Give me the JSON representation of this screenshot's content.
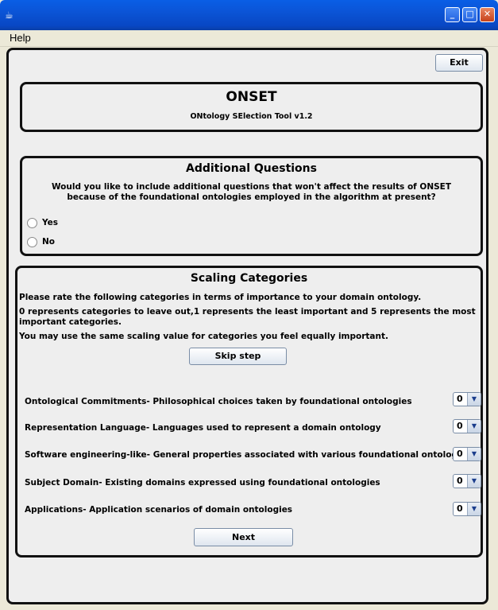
{
  "window": {
    "app_icon_glyph": "☕",
    "minimize_glyph": "_",
    "maximize_glyph": "□",
    "close_glyph": "✕"
  },
  "menu": {
    "help_label": "Help"
  },
  "exit_button_label": "Exit",
  "header": {
    "title": "ONSET",
    "subtitle": "ONtology SElection Tool  v1.2"
  },
  "additional_questions": {
    "title": "Additional Questions",
    "question_line1": "Would you like to include additional questions that won't affect the results of ONSET",
    "question_line2": "because of the foundational ontologies employed in the algorithm at present?",
    "options": [
      {
        "label": "Yes",
        "selected": false
      },
      {
        "label": "No",
        "selected": false
      }
    ]
  },
  "scaling": {
    "title": "Scaling Categories",
    "instructions": [
      "Please rate the following categories in terms of importance to your domain ontology.",
      "0 represents categories to leave out,1 represents the least important and 5 represents the most",
      "important categories.",
      "You may use the same scaling value for categories you feel equally important."
    ],
    "skip_button_label": "Skip step",
    "categories": [
      {
        "label": "Ontological Commitments- Philosophical choices taken by foundational ontologies",
        "value": "0"
      },
      {
        "label": "Representation Language- Languages used to represent a domain ontology",
        "value": "0"
      },
      {
        "label": "Software engineering-like- General properties associated with various foundational ontologies",
        "value": "0"
      },
      {
        "label": "Subject Domain- Existing domains expressed using foundational ontologies",
        "value": "0"
      },
      {
        "label": "Applications-  Application scenarios of domain ontologies",
        "value": "0"
      }
    ],
    "combo_arrow_glyph": "▼",
    "next_button_label": "Next"
  }
}
